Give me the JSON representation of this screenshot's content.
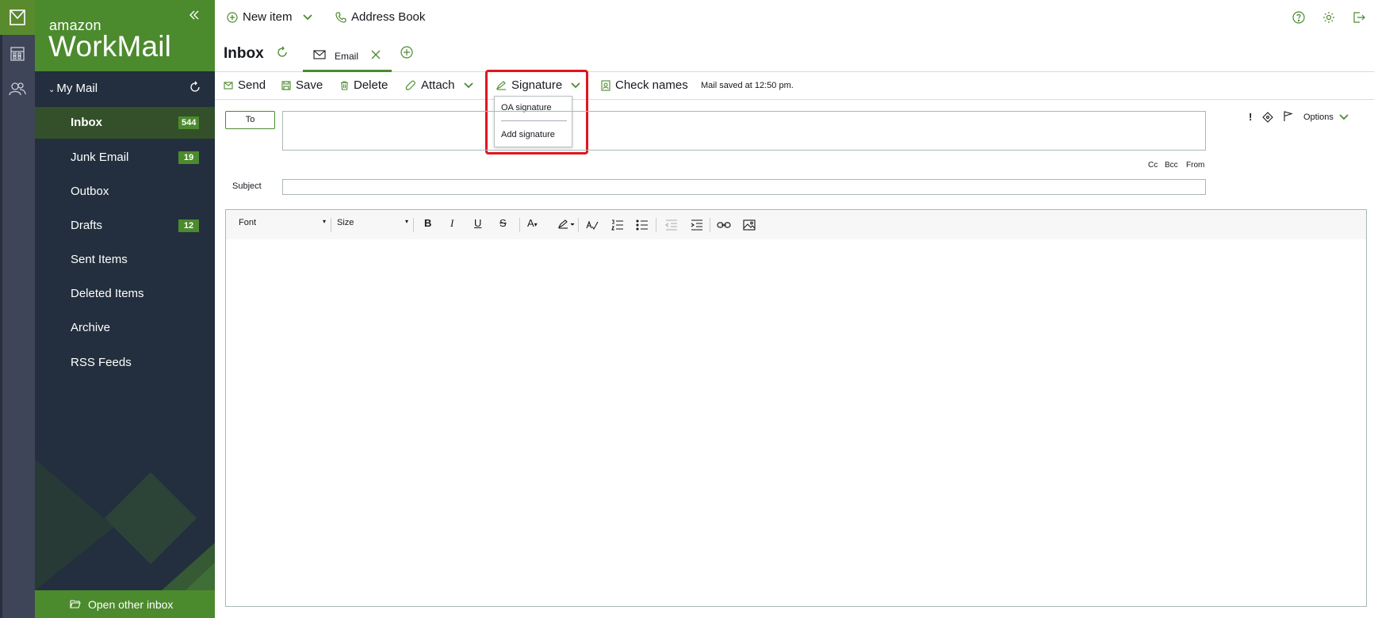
{
  "brand": {
    "small": "amazon",
    "big": "WorkMail"
  },
  "rail": {
    "icons": [
      "mail-icon",
      "calendar-icon",
      "contacts-icon"
    ]
  },
  "sidebar": {
    "section": "My Mail",
    "folders": [
      {
        "name": "Inbox",
        "count": "544"
      },
      {
        "name": "Junk Email",
        "count": "19"
      },
      {
        "name": "Outbox",
        "count": ""
      },
      {
        "name": "Drafts",
        "count": "12"
      },
      {
        "name": "Sent Items",
        "count": ""
      },
      {
        "name": "Deleted Items",
        "count": ""
      },
      {
        "name": "Archive",
        "count": ""
      },
      {
        "name": "RSS Feeds",
        "count": ""
      }
    ],
    "open_other": "Open other inbox"
  },
  "topbar": {
    "new_item": "New item",
    "address_book": "Address Book"
  },
  "tabs": {
    "inbox": "Inbox",
    "email": "Email"
  },
  "toolbar": {
    "send": "Send",
    "save": "Save",
    "delete": "Delete",
    "attach": "Attach",
    "signature": "Signature",
    "check_names": "Check names",
    "saved_msg": "Mail saved at 12:50 pm."
  },
  "signature_menu": {
    "items": [
      "OA signature",
      "Add signature"
    ]
  },
  "compose": {
    "to": "To",
    "subject": "Subject",
    "cc": "Cc",
    "bcc": "Bcc",
    "from": "From",
    "importance": "!",
    "options": "Options"
  },
  "editor": {
    "font": "Font",
    "size": "Size"
  },
  "colors": {
    "brand_green": "#4c8a2e",
    "sidebar_bg": "#232f3e",
    "highlight": "#e0161e"
  }
}
